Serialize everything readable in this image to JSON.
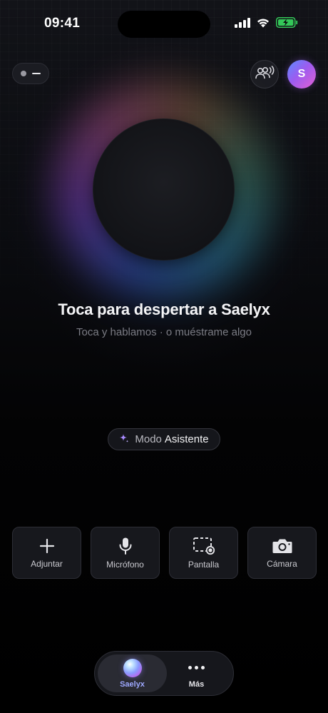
{
  "status_bar": {
    "time": "09:41",
    "icons": [
      "cellular-signal-icon",
      "wifi-icon",
      "battery-charging-icon"
    ]
  },
  "top_bar": {
    "mode_toggle_icon": "status-toggle-icon",
    "people_icon": "people-broadcast-icon",
    "avatar_initial": "S"
  },
  "hero": {
    "headline": "Toca para despertar a Saelyx",
    "subline": "Toca y hablamos · o muéstrame algo"
  },
  "mode_chip": {
    "icon": "sparkle-icon",
    "prefix": "Modo",
    "value": "Asistente"
  },
  "actions": [
    {
      "icon": "plus-icon",
      "label": "Adjuntar"
    },
    {
      "icon": "microphone-icon",
      "label": "Micrófono"
    },
    {
      "icon": "screen-record-icon",
      "label": "Pantalla"
    },
    {
      "icon": "camera-icon",
      "label": "Cámara"
    }
  ],
  "tabbar": {
    "tabs": [
      {
        "icon": "saelyx-orb-icon",
        "label": "Saelyx",
        "active": true
      },
      {
        "icon": "more-dots-icon",
        "label": "Más",
        "active": false
      }
    ]
  },
  "colors": {
    "accent": "#9ea8ff",
    "avatar_gradient_start": "#5a8dff",
    "avatar_gradient_end": "#e35fd3",
    "battery_green": "#34c759"
  }
}
